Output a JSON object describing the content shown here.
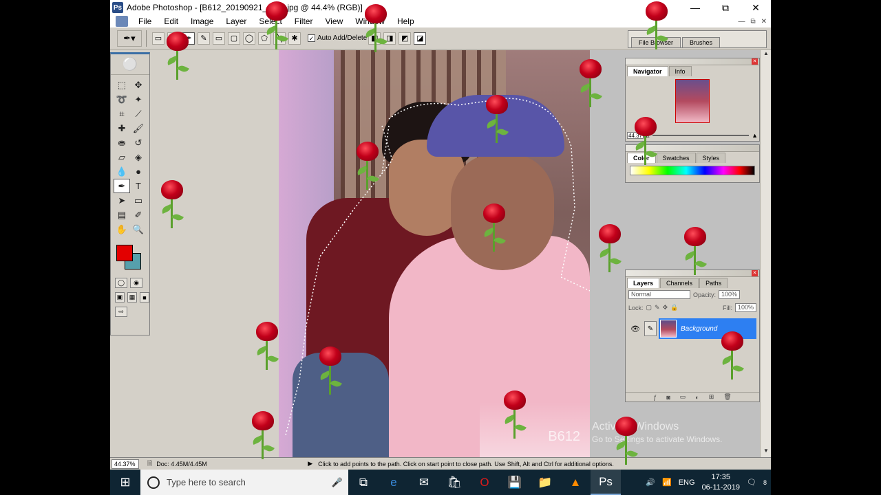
{
  "window": {
    "app_name": "Adobe Photoshop",
    "doc_title": "Adobe Photoshop - [B612_20190921_1122.jpg @ 44.4% (RGB)]",
    "minimize": "—",
    "maximize": "⧉",
    "close": "✕"
  },
  "menu": [
    "File",
    "Edit",
    "Image",
    "Layer",
    "Select",
    "Filter",
    "View",
    "Window",
    "Help"
  ],
  "options_bar": {
    "auto_add_delete": "Auto Add/Delete"
  },
  "palette_well": {
    "tabs": [
      "File Browser",
      "Brushes"
    ]
  },
  "navigator": {
    "tabs": [
      "Navigator",
      "Info"
    ],
    "zoom": "44.37%"
  },
  "color_palette": {
    "tabs": [
      "Color",
      "Swatches",
      "Styles"
    ]
  },
  "layers_palette": {
    "tabs": [
      "Layers",
      "Channels",
      "Paths"
    ],
    "blend_mode": "Normal",
    "opacity_label": "Opacity:",
    "opacity": "100%",
    "lock_label": "Lock:",
    "fill_label": "Fill:",
    "fill": "100%",
    "layer_name": "Background"
  },
  "status_bar": {
    "zoom": "44.37%",
    "doc": "Doc: 4.45M/4.45M",
    "hint": "Click to add points to the path.  Click on start point to close path.  Use Shift, Alt and Ctrl for additional options."
  },
  "watermark": {
    "canvas_text": "B612",
    "line1": "Activate Windows",
    "line2": "Go to Settings to activate Windows."
  },
  "taskbar": {
    "search_placeholder": "Type here to search",
    "language": "ENG",
    "time": "17:35",
    "date": "06-11-2019",
    "notifications": "8"
  },
  "colors": {
    "foreground": "#e30000",
    "background": "#56a0ac",
    "layer_selected": "#2d7ff2"
  }
}
